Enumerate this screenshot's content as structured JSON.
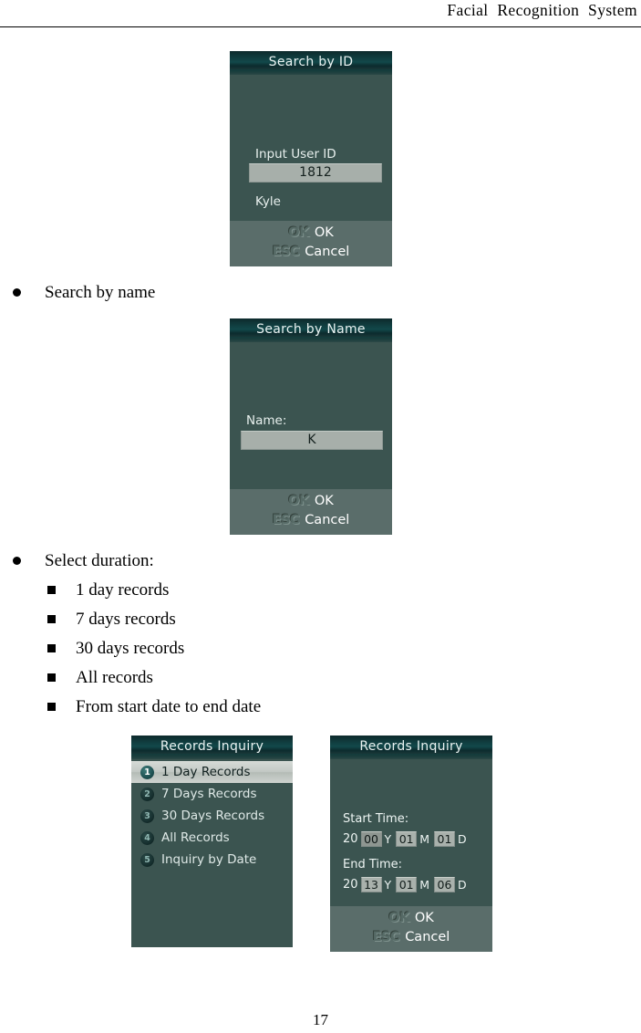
{
  "header": {
    "title": "Facial  Recognition  System"
  },
  "page_number": "17",
  "bullets": {
    "search_by_name": "Search by name",
    "select_duration": "Select duration:",
    "duration_items": [
      "1 day records",
      "7 days records",
      "30 days records",
      "All records",
      "From start date to end date"
    ]
  },
  "screens": {
    "search_by_id": {
      "title": "Search by ID",
      "field_label": "Input User ID",
      "field_value": "1812",
      "result_name": "Kyle",
      "ok_key": "OK",
      "ok_label": "OK",
      "cancel_key": "ESC",
      "cancel_label": "Cancel"
    },
    "search_by_name": {
      "title": "Search by Name",
      "field_label": "Name:",
      "field_value": "K",
      "ok_key": "OK",
      "ok_label": "OK",
      "cancel_key": "ESC",
      "cancel_label": "Cancel"
    },
    "records_inquiry_menu": {
      "title": "Records Inquiry",
      "items": [
        {
          "index": "1",
          "label": "1 Day Records",
          "selected": true
        },
        {
          "index": "2",
          "label": "7 Days Records",
          "selected": false
        },
        {
          "index": "3",
          "label": "30 Days Records",
          "selected": false
        },
        {
          "index": "4",
          "label": "All Records",
          "selected": false
        },
        {
          "index": "5",
          "label": "Inquiry by Date",
          "selected": false
        }
      ]
    },
    "records_inquiry_date": {
      "title": "Records Inquiry",
      "start_label": "Start Time:",
      "start": {
        "century": "20",
        "year": "00",
        "year_unit": "Y",
        "month": "01",
        "month_unit": "M",
        "day": "01",
        "day_unit": "D"
      },
      "end_label": "End Time:",
      "end": {
        "century": "20",
        "year": "13",
        "year_unit": "Y",
        "month": "01",
        "month_unit": "M",
        "day": "06",
        "day_unit": "D"
      },
      "ok_key": "OK",
      "ok_label": "OK",
      "cancel_key": "ESC",
      "cancel_label": "Cancel"
    }
  },
  "colors": {
    "screen_bg": "#3b5450",
    "title_bar": "#12494b",
    "footer_bg": "#5a6d6a",
    "input_bg": "#a7afaa",
    "selected_row": "#c3c9c5"
  }
}
